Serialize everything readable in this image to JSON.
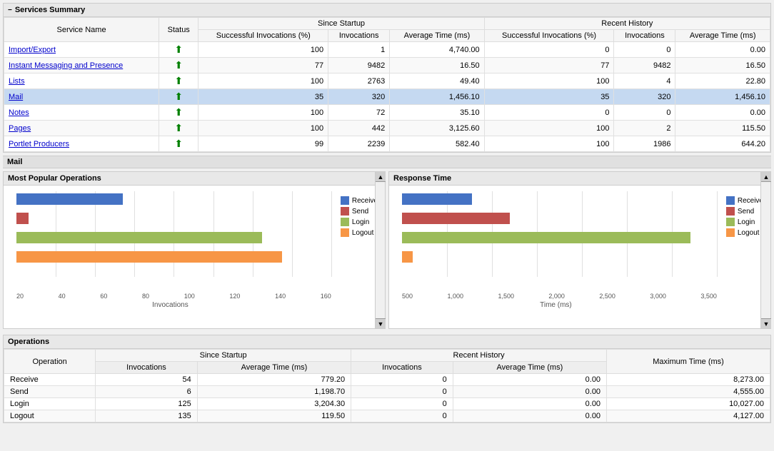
{
  "services_summary": {
    "title": "Services Summary",
    "columns": {
      "service_name": "Service Name",
      "status": "Status",
      "since_startup": "Since Startup",
      "recent_history": "Recent History",
      "successful_invocations": "Successful Invocations (%)",
      "invocations": "Invocations",
      "average_time_ms": "Average Time (ms)"
    },
    "services": [
      {
        "name": "Import/Export",
        "status": "up",
        "ss_pct": "100",
        "ss_inv": "1",
        "ss_avg": "4,740.00",
        "rh_pct": "0",
        "rh_inv": "0",
        "rh_avg": "0.00",
        "selected": false
      },
      {
        "name": "Instant Messaging and Presence",
        "status": "up",
        "ss_pct": "77",
        "ss_inv": "9482",
        "ss_avg": "16.50",
        "rh_pct": "77",
        "rh_inv": "9482",
        "rh_avg": "16.50",
        "selected": false
      },
      {
        "name": "Lists",
        "status": "up",
        "ss_pct": "100",
        "ss_inv": "2763",
        "ss_avg": "49.40",
        "rh_pct": "100",
        "rh_inv": "4",
        "rh_avg": "22.80",
        "selected": false
      },
      {
        "name": "Mail",
        "status": "up",
        "ss_pct": "35",
        "ss_inv": "320",
        "ss_avg": "1,456.10",
        "rh_pct": "35",
        "rh_inv": "320",
        "rh_avg": "1,456.10",
        "selected": true
      },
      {
        "name": "Notes",
        "status": "up",
        "ss_pct": "100",
        "ss_inv": "72",
        "ss_avg": "35.10",
        "rh_pct": "0",
        "rh_inv": "0",
        "rh_avg": "0.00",
        "selected": false
      },
      {
        "name": "Pages",
        "status": "up",
        "ss_pct": "100",
        "ss_inv": "442",
        "ss_avg": "3,125.60",
        "rh_pct": "100",
        "rh_inv": "2",
        "rh_avg": "115.50",
        "selected": false
      },
      {
        "name": "Portlet Producers",
        "status": "up",
        "ss_pct": "99",
        "ss_inv": "2239",
        "ss_avg": "582.40",
        "rh_pct": "100",
        "rh_inv": "1986",
        "rh_avg": "644.20",
        "selected": false
      }
    ]
  },
  "mail_section": {
    "title": "Mail"
  },
  "most_popular": {
    "title": "Most Popular Operations",
    "legend": [
      {
        "label": "Receive",
        "color": "#4472c4"
      },
      {
        "label": "Send",
        "color": "#c0504d"
      },
      {
        "label": "Login",
        "color": "#9bbb59"
      },
      {
        "label": "Logout",
        "color": "#f79646"
      }
    ],
    "bars": [
      {
        "label": "Receive",
        "value": 54,
        "color": "#4472c4",
        "max": 160
      },
      {
        "label": "Send",
        "value": 6,
        "color": "#c0504d",
        "max": 160
      },
      {
        "label": "Login",
        "value": 125,
        "color": "#9bbb59",
        "max": 160
      },
      {
        "label": "Logout",
        "value": 135,
        "color": "#f79646",
        "max": 160
      }
    ],
    "x_labels": [
      "20",
      "40",
      "60",
      "80",
      "100",
      "120",
      "140",
      "160"
    ],
    "x_title": "Invocations"
  },
  "response_time": {
    "title": "Response Time",
    "bars": [
      {
        "label": "Receive",
        "value": 779.2,
        "color": "#4472c4",
        "max": 3500
      },
      {
        "label": "Send",
        "value": 1198.7,
        "color": "#c0504d",
        "max": 3500
      },
      {
        "label": "Login",
        "value": 3204.3,
        "color": "#9bbb59",
        "max": 3500
      },
      {
        "label": "Logout",
        "value": 119.5,
        "color": "#f79646",
        "max": 3500
      }
    ],
    "x_labels": [
      "500",
      "1,000",
      "1,500",
      "2,000",
      "2,500",
      "3,000",
      "3,500"
    ],
    "x_title": "Time (ms)"
  },
  "operations": {
    "title": "Operations",
    "columns": {
      "operation": "Operation",
      "since_startup": "Since Startup",
      "recent_history": "Recent History",
      "maximum_time": "Maximum Time (ms)",
      "invocations": "Invocations",
      "average_time_ms": "Average Time (ms)"
    },
    "rows": [
      {
        "name": "Receive",
        "ss_inv": "54",
        "ss_avg": "779.20",
        "rh_inv": "0",
        "rh_avg": "0.00",
        "max_time": "8,273.00"
      },
      {
        "name": "Send",
        "ss_inv": "6",
        "ss_avg": "1,198.70",
        "rh_inv": "0",
        "rh_avg": "0.00",
        "max_time": "4,555.00"
      },
      {
        "name": "Login",
        "ss_inv": "125",
        "ss_avg": "3,204.30",
        "rh_inv": "0",
        "rh_avg": "0.00",
        "max_time": "10,027.00"
      },
      {
        "name": "Logout",
        "ss_inv": "135",
        "ss_avg": "119.50",
        "rh_inv": "0",
        "rh_avg": "0.00",
        "max_time": "4,127.00"
      }
    ]
  },
  "icons": {
    "collapse": "−",
    "up_arrow": "⬆",
    "scroll_up": "▲",
    "scroll_down": "▼"
  }
}
